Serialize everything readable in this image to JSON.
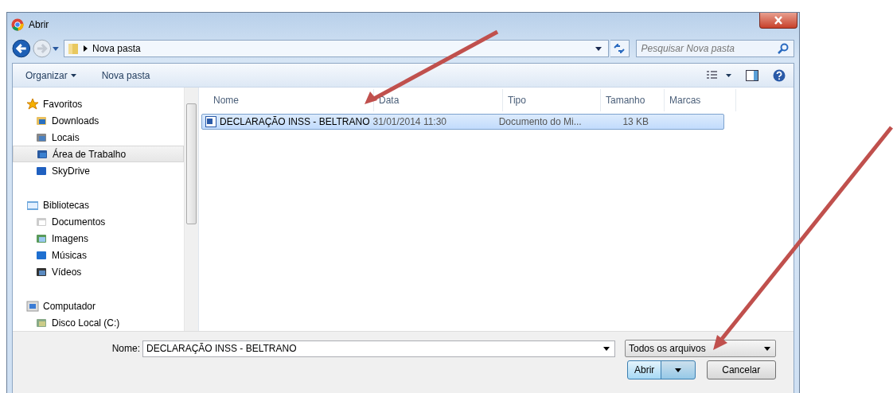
{
  "window": {
    "title": "Abrir"
  },
  "address": {
    "path": "Nova pasta"
  },
  "search": {
    "placeholder": "Pesquisar Nova pasta"
  },
  "toolbar": {
    "items": [
      "Organizar",
      "Nova pasta"
    ]
  },
  "sidebar": {
    "groups": [
      {
        "label": "Favoritos",
        "selected": false,
        "children": [
          {
            "label": "Downloads",
            "selected": false
          },
          {
            "label": "Locais",
            "selected": false
          },
          {
            "label": "Área de Trabalho",
            "selected": true
          },
          {
            "label": "SkyDrive",
            "selected": false
          }
        ]
      },
      {
        "label": "Bibliotecas",
        "selected": false,
        "children": [
          {
            "label": "Documentos",
            "selected": false
          },
          {
            "label": "Imagens",
            "selected": false
          },
          {
            "label": "Músicas",
            "selected": false
          },
          {
            "label": "Vídeos",
            "selected": false
          }
        ]
      },
      {
        "label": "Computador",
        "selected": false,
        "children": [
          {
            "label": "Disco Local (C:)",
            "selected": false
          }
        ]
      }
    ]
  },
  "table": {
    "columns": [
      "Nome",
      "Data",
      "Tipo",
      "Tamanho",
      "Marcas"
    ],
    "rows": [
      {
        "cells": [
          "DECLARAÇÃO INSS - BELTRANO",
          "31/01/2014 11:30",
          "Documento do Mi...",
          "13 KB",
          ""
        ],
        "selected": true
      }
    ]
  },
  "footer": {
    "name_label": "Nome:",
    "name_value": "DECLARAÇÃO INSS - BELTRANO",
    "filter": "Todos os arquivos",
    "buttons": [
      "Abrir",
      "Cancelar"
    ]
  }
}
